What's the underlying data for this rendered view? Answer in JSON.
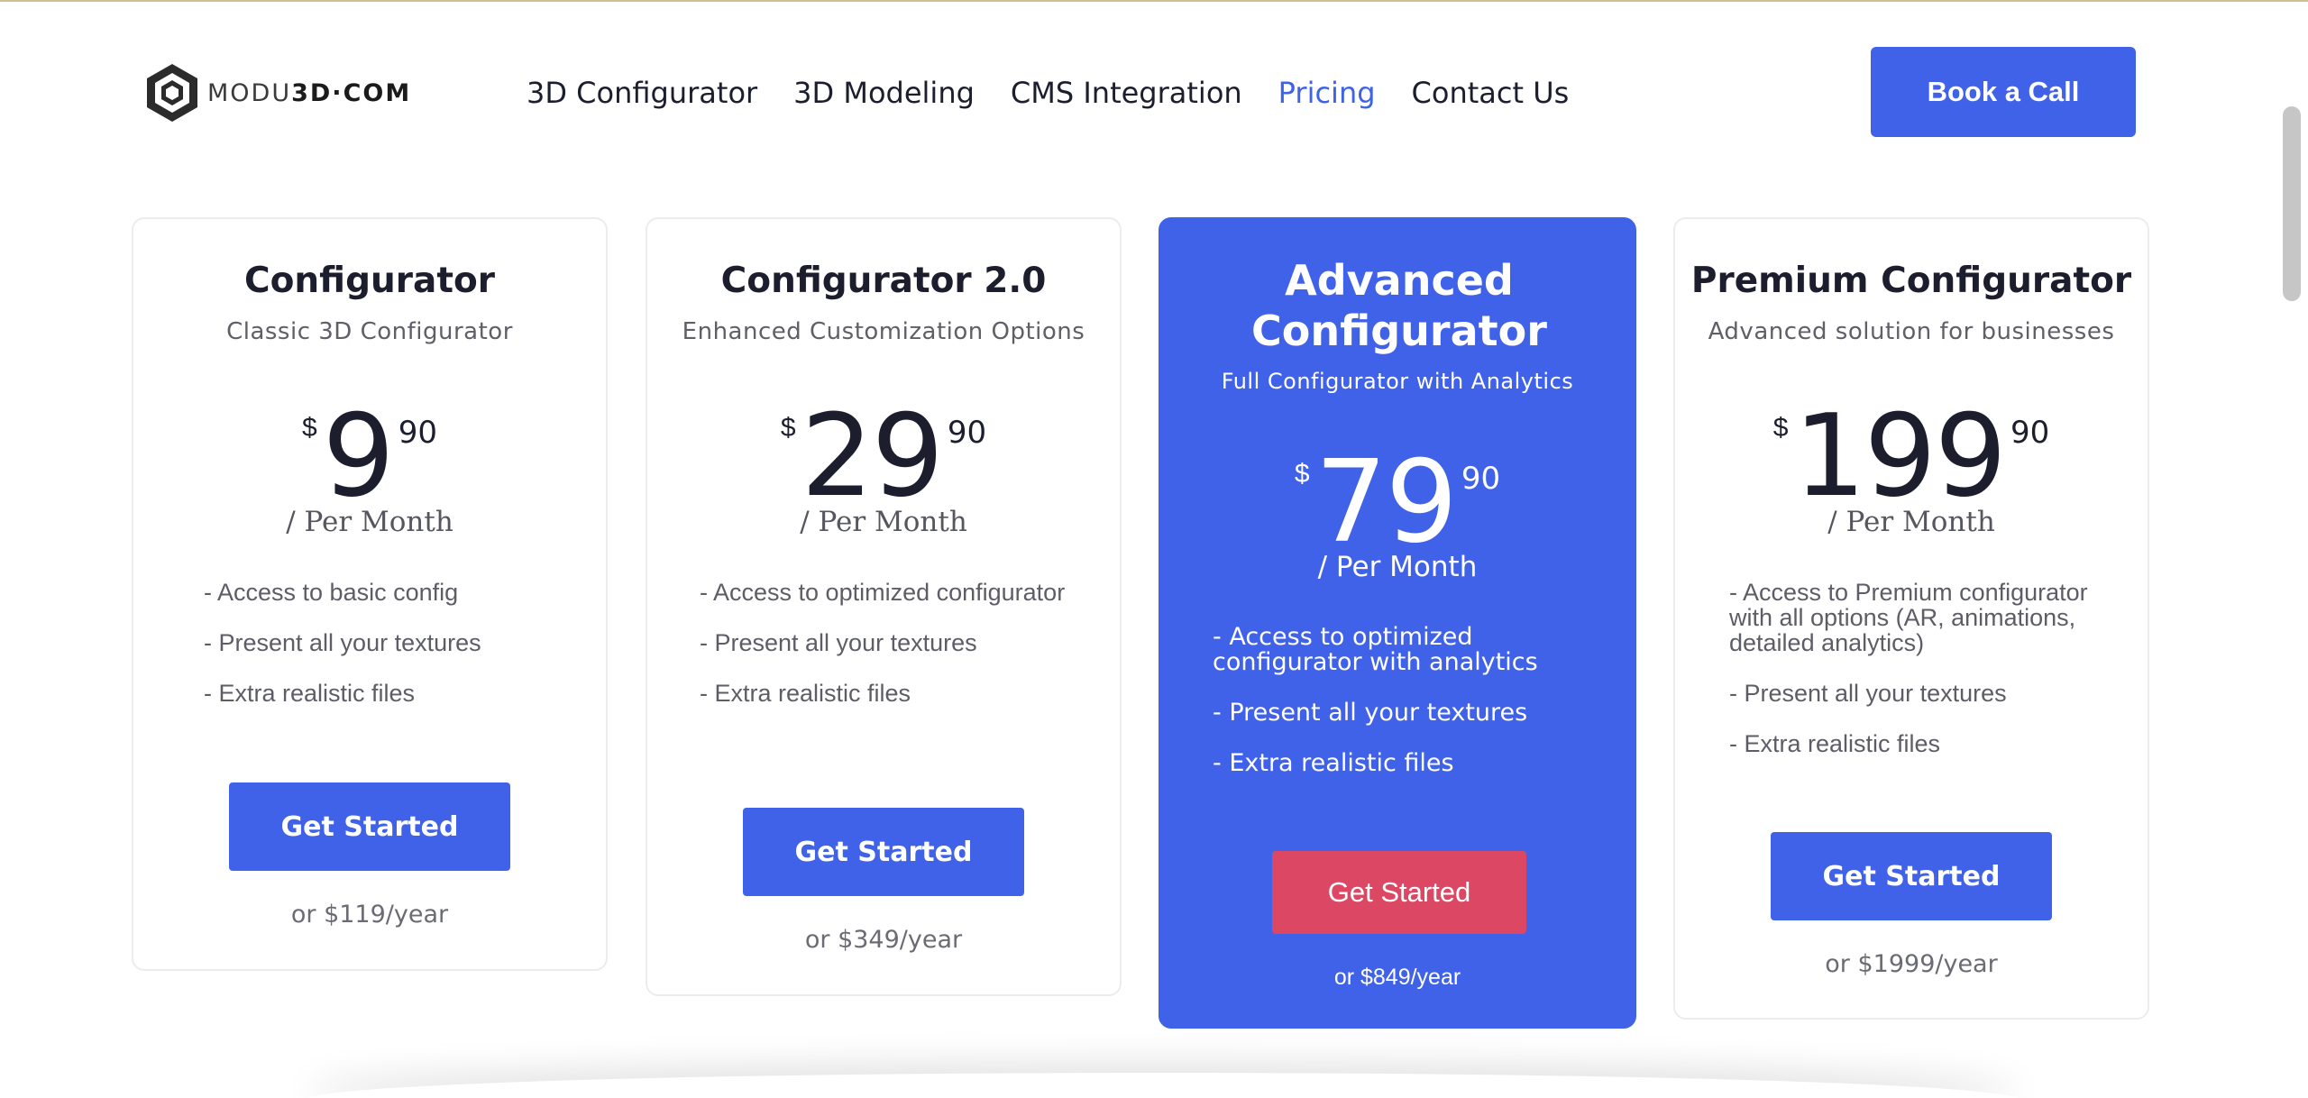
{
  "colors": {
    "accent": "#4062e8",
    "cta_featured": "#dc4864",
    "nav_active": "#3e63e6"
  },
  "header": {
    "logo": {
      "icon": "modu3d-cube-logo-icon",
      "text_light": "MODU",
      "text_bold": "3D·COM"
    },
    "nav": [
      "3D Configurator",
      "3D Modeling",
      "CMS Integration",
      "Pricing",
      "Contact Us"
    ],
    "active_nav": "Pricing",
    "cta_label": "Book a Call"
  },
  "plans": [
    {
      "title": "Configurator",
      "subtitle": "Classic 3D Configurator",
      "currency": "$",
      "amount": "9",
      "cents": "90",
      "period": "/ Per Month",
      "features": [
        "- Access to basic config",
        "- Present all your textures",
        "- Extra realistic files"
      ],
      "cta": "Get Started",
      "yearly": "or $119/year"
    },
    {
      "title": "Configurator 2.0",
      "subtitle": "Enhanced Customization Options",
      "currency": "$",
      "amount": "29",
      "cents": "90",
      "period": "/ Per Month",
      "features": [
        "- Access to optimized configurator",
        "- Present all your textures",
        "- Extra realistic files"
      ],
      "cta": "Get Started",
      "yearly": "or $349/year"
    },
    {
      "title": "Advanced Configurator",
      "subtitle": "Full Configurator with Analytics",
      "currency": "$",
      "amount": "79",
      "cents": "90",
      "period": "/ Per Month",
      "features": [
        "- Access to optimized configurator with analytics",
        "- Present all your textures",
        "- Extra realistic files"
      ],
      "cta": "Get Started",
      "yearly": "or $849/year",
      "featured": true
    },
    {
      "title": "Premium Configurator",
      "subtitle": "Advanced solution for businesses",
      "currency": "$",
      "amount": "199",
      "cents": "90",
      "period": "/ Per Month",
      "features": [
        "- Access to Premium configurator with all options (AR, animations, detailed analytics)",
        "- Present all your textures",
        "- Extra realistic files"
      ],
      "cta": "Get Started",
      "yearly": "or $1999/year"
    }
  ]
}
